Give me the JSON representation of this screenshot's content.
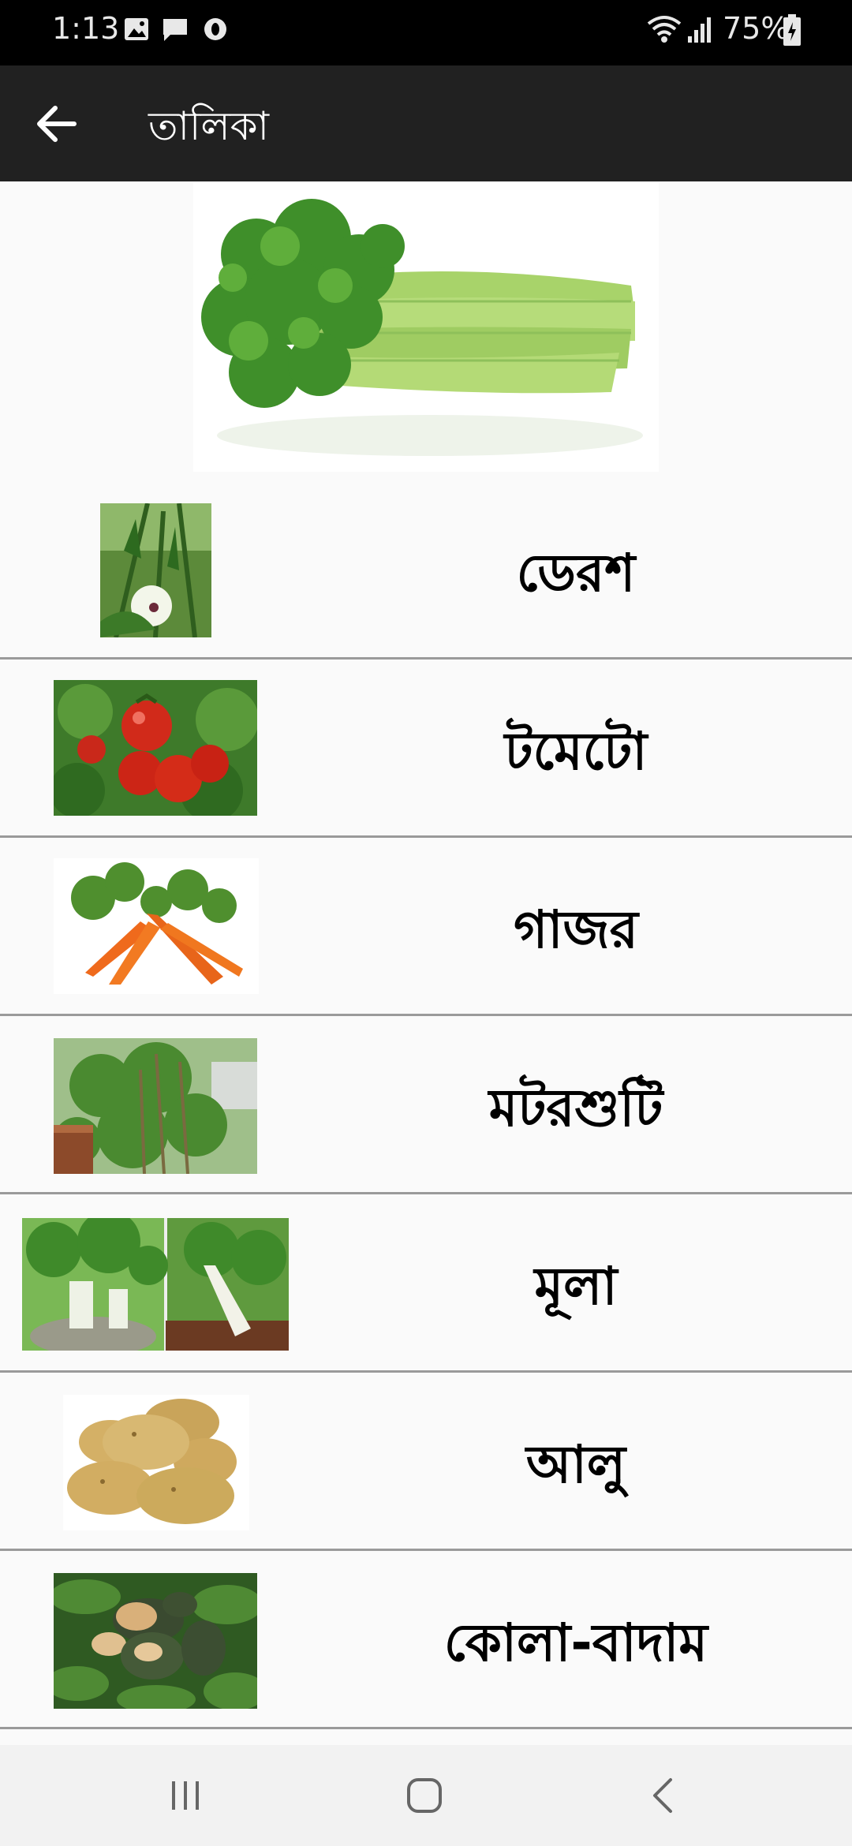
{
  "status_bar": {
    "time": "1:13",
    "battery": "75%",
    "icons": [
      "image-icon",
      "message-icon",
      "circle-o-icon",
      "wifi-icon",
      "signal-icon",
      "battery-icon"
    ]
  },
  "app_bar": {
    "title": "তালিকা",
    "back_icon": "arrow-left-icon"
  },
  "hero_image": "celery-image",
  "list": {
    "items": [
      {
        "label": "ডেরশ",
        "image": "okra-plant-image"
      },
      {
        "label": "টমেটো",
        "image": "tomato-image"
      },
      {
        "label": "গাজর",
        "image": "carrot-image"
      },
      {
        "label": "মটরশুটি",
        "image": "beans-plant-image"
      },
      {
        "label": "মূলা",
        "image": "radish-image"
      },
      {
        "label": "আলু",
        "image": "potato-image"
      },
      {
        "label": "কোলা-বাদাম",
        "image": "kola-nut-image"
      }
    ]
  },
  "nav_bar": {
    "icons": [
      "recents-icon",
      "home-icon",
      "back-icon"
    ]
  },
  "colors": {
    "status_bar": "#000000",
    "app_bar": "#212121",
    "background": "#fafafa",
    "divider": "#9a9a9a"
  }
}
